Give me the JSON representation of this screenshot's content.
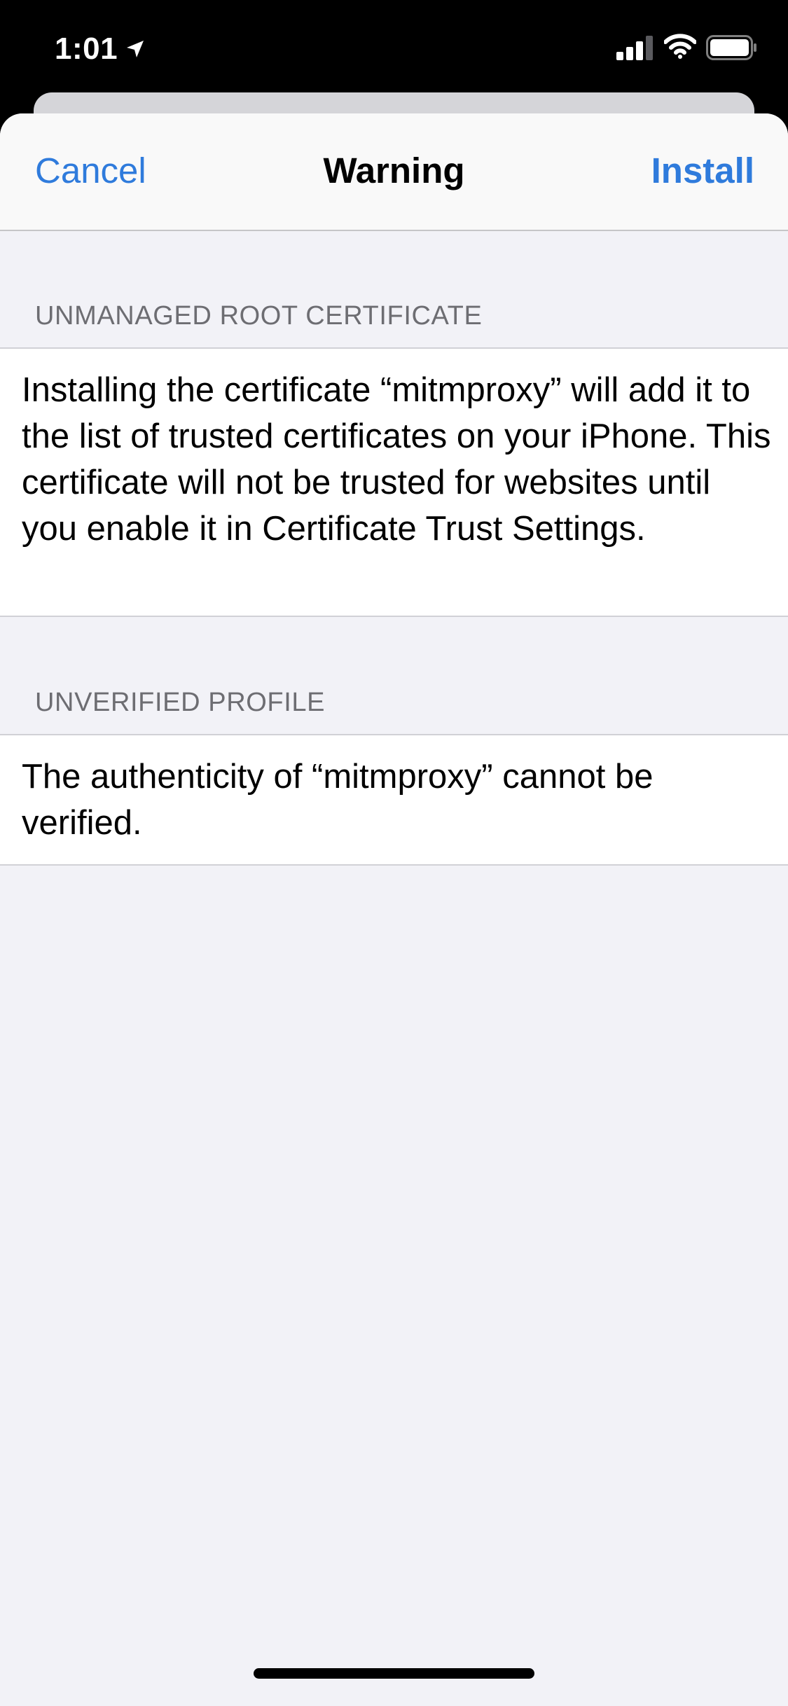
{
  "status_bar": {
    "time": "1:01",
    "icons": [
      "location-arrow-icon",
      "cellular-signal-icon",
      "wifi-icon",
      "battery-icon"
    ]
  },
  "nav": {
    "cancel_label": "Cancel",
    "title": "Warning",
    "install_label": "Install"
  },
  "sections": [
    {
      "header": "UNMANAGED ROOT CERTIFICATE",
      "body": "Installing the certificate “mitmproxy” will add it to the list of trusted certificates on your iPhone. This certificate will not be trusted for websites until you enable it in Certificate Trust Settings."
    },
    {
      "header": "UNVERIFIED PROFILE",
      "body": "The authenticity of “mitmproxy” cannot be verified."
    }
  ],
  "colors": {
    "accent": "#2f7bdc",
    "grouped_background": "#f2f2f7",
    "section_header": "#6d6d72"
  }
}
